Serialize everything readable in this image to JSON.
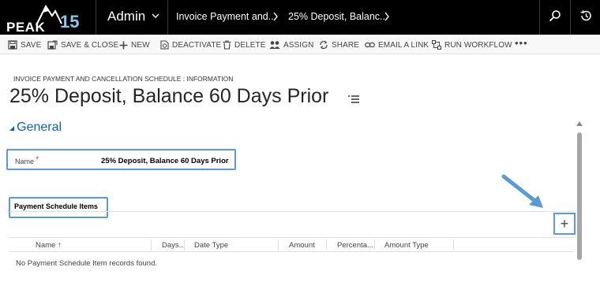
{
  "nav": {
    "logo_text": "PEAK",
    "logo_number": "15",
    "app_name": "Admin",
    "breadcrumb": [
      "Invoice Payment and...",
      "25% Deposit, Balanc..."
    ]
  },
  "icons": {
    "search": "search-icon",
    "history": "history-icon",
    "more": "more-icon"
  },
  "toolbar": {
    "save": "SAVE",
    "save_close": "SAVE & CLOSE",
    "new": "NEW",
    "deactivate": "DEACTIVATE",
    "delete": "DELETE",
    "assign": "ASSIGN",
    "share": "SHARE",
    "email_link": "EMAIL A LINK",
    "run_workflow": "RUN WORKFLOW",
    "more": "•••"
  },
  "record": {
    "entity_label": "INVOICE PAYMENT AND CANCELLATION SCHEDULE : INFORMATION",
    "title": "25% Deposit, Balance 60 Days Prior"
  },
  "section": {
    "title": "General"
  },
  "form": {
    "name_label": "Name",
    "required_marker": "*",
    "name_value": "25% Deposit, Balance 60 Days Prior"
  },
  "subgrid": {
    "label": "Payment Schedule Items",
    "add_symbol": "+",
    "columns": [
      "Name ↑",
      "Days...",
      "Date Type",
      "Amount",
      "Percenta...",
      "Amount Type"
    ],
    "empty_message": "No Payment Schedule Item records found."
  },
  "colors": {
    "accent_blue": "#1160b7",
    "highlight": "#5b9bd5",
    "topbar": "#000000"
  }
}
